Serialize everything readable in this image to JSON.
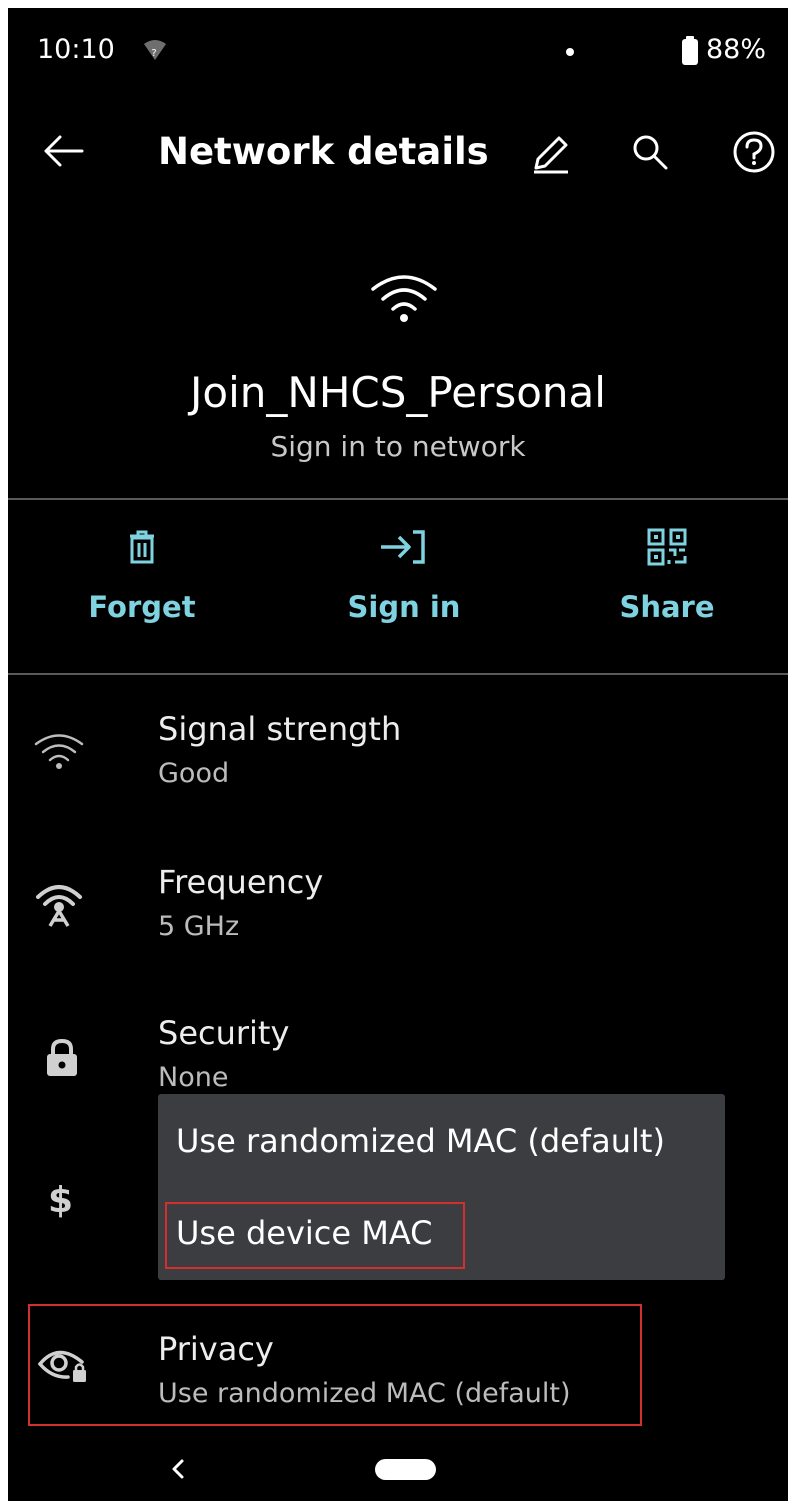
{
  "status_bar": {
    "time": "10:10",
    "battery": "88%"
  },
  "app_bar": {
    "title": "Network details",
    "icons": [
      "back-arrow-icon",
      "edit-pencil-icon",
      "search-icon",
      "help-icon"
    ]
  },
  "network": {
    "name": "Join_NHCS_Personal",
    "status": "Sign in to network"
  },
  "actions": [
    {
      "label": "Forget",
      "icon": "trash-icon"
    },
    {
      "label": "Sign in",
      "icon": "sign-in-icon"
    },
    {
      "label": "Share",
      "icon": "qr-code-icon"
    }
  ],
  "details": [
    {
      "title": "Signal strength",
      "value": "Good",
      "icon": "wifi-signal-icon"
    },
    {
      "title": "Frequency",
      "value": "5 GHz",
      "icon": "antenna-icon"
    },
    {
      "title": "Security",
      "value": "None",
      "icon": "lock-icon"
    },
    {
      "title": "",
      "value": "",
      "icon": "dollar-icon"
    },
    {
      "title": "Privacy",
      "value": "Use randomized MAC (default)",
      "icon": "privacy-eye-icon"
    }
  ],
  "menu": {
    "options": [
      "Use randomized MAC (default)",
      "Use device MAC"
    ]
  },
  "colors": {
    "accent": "#7fd2e0",
    "background": "#000000",
    "menu_background": "#3b3d40",
    "highlight": "#d32f2f"
  }
}
